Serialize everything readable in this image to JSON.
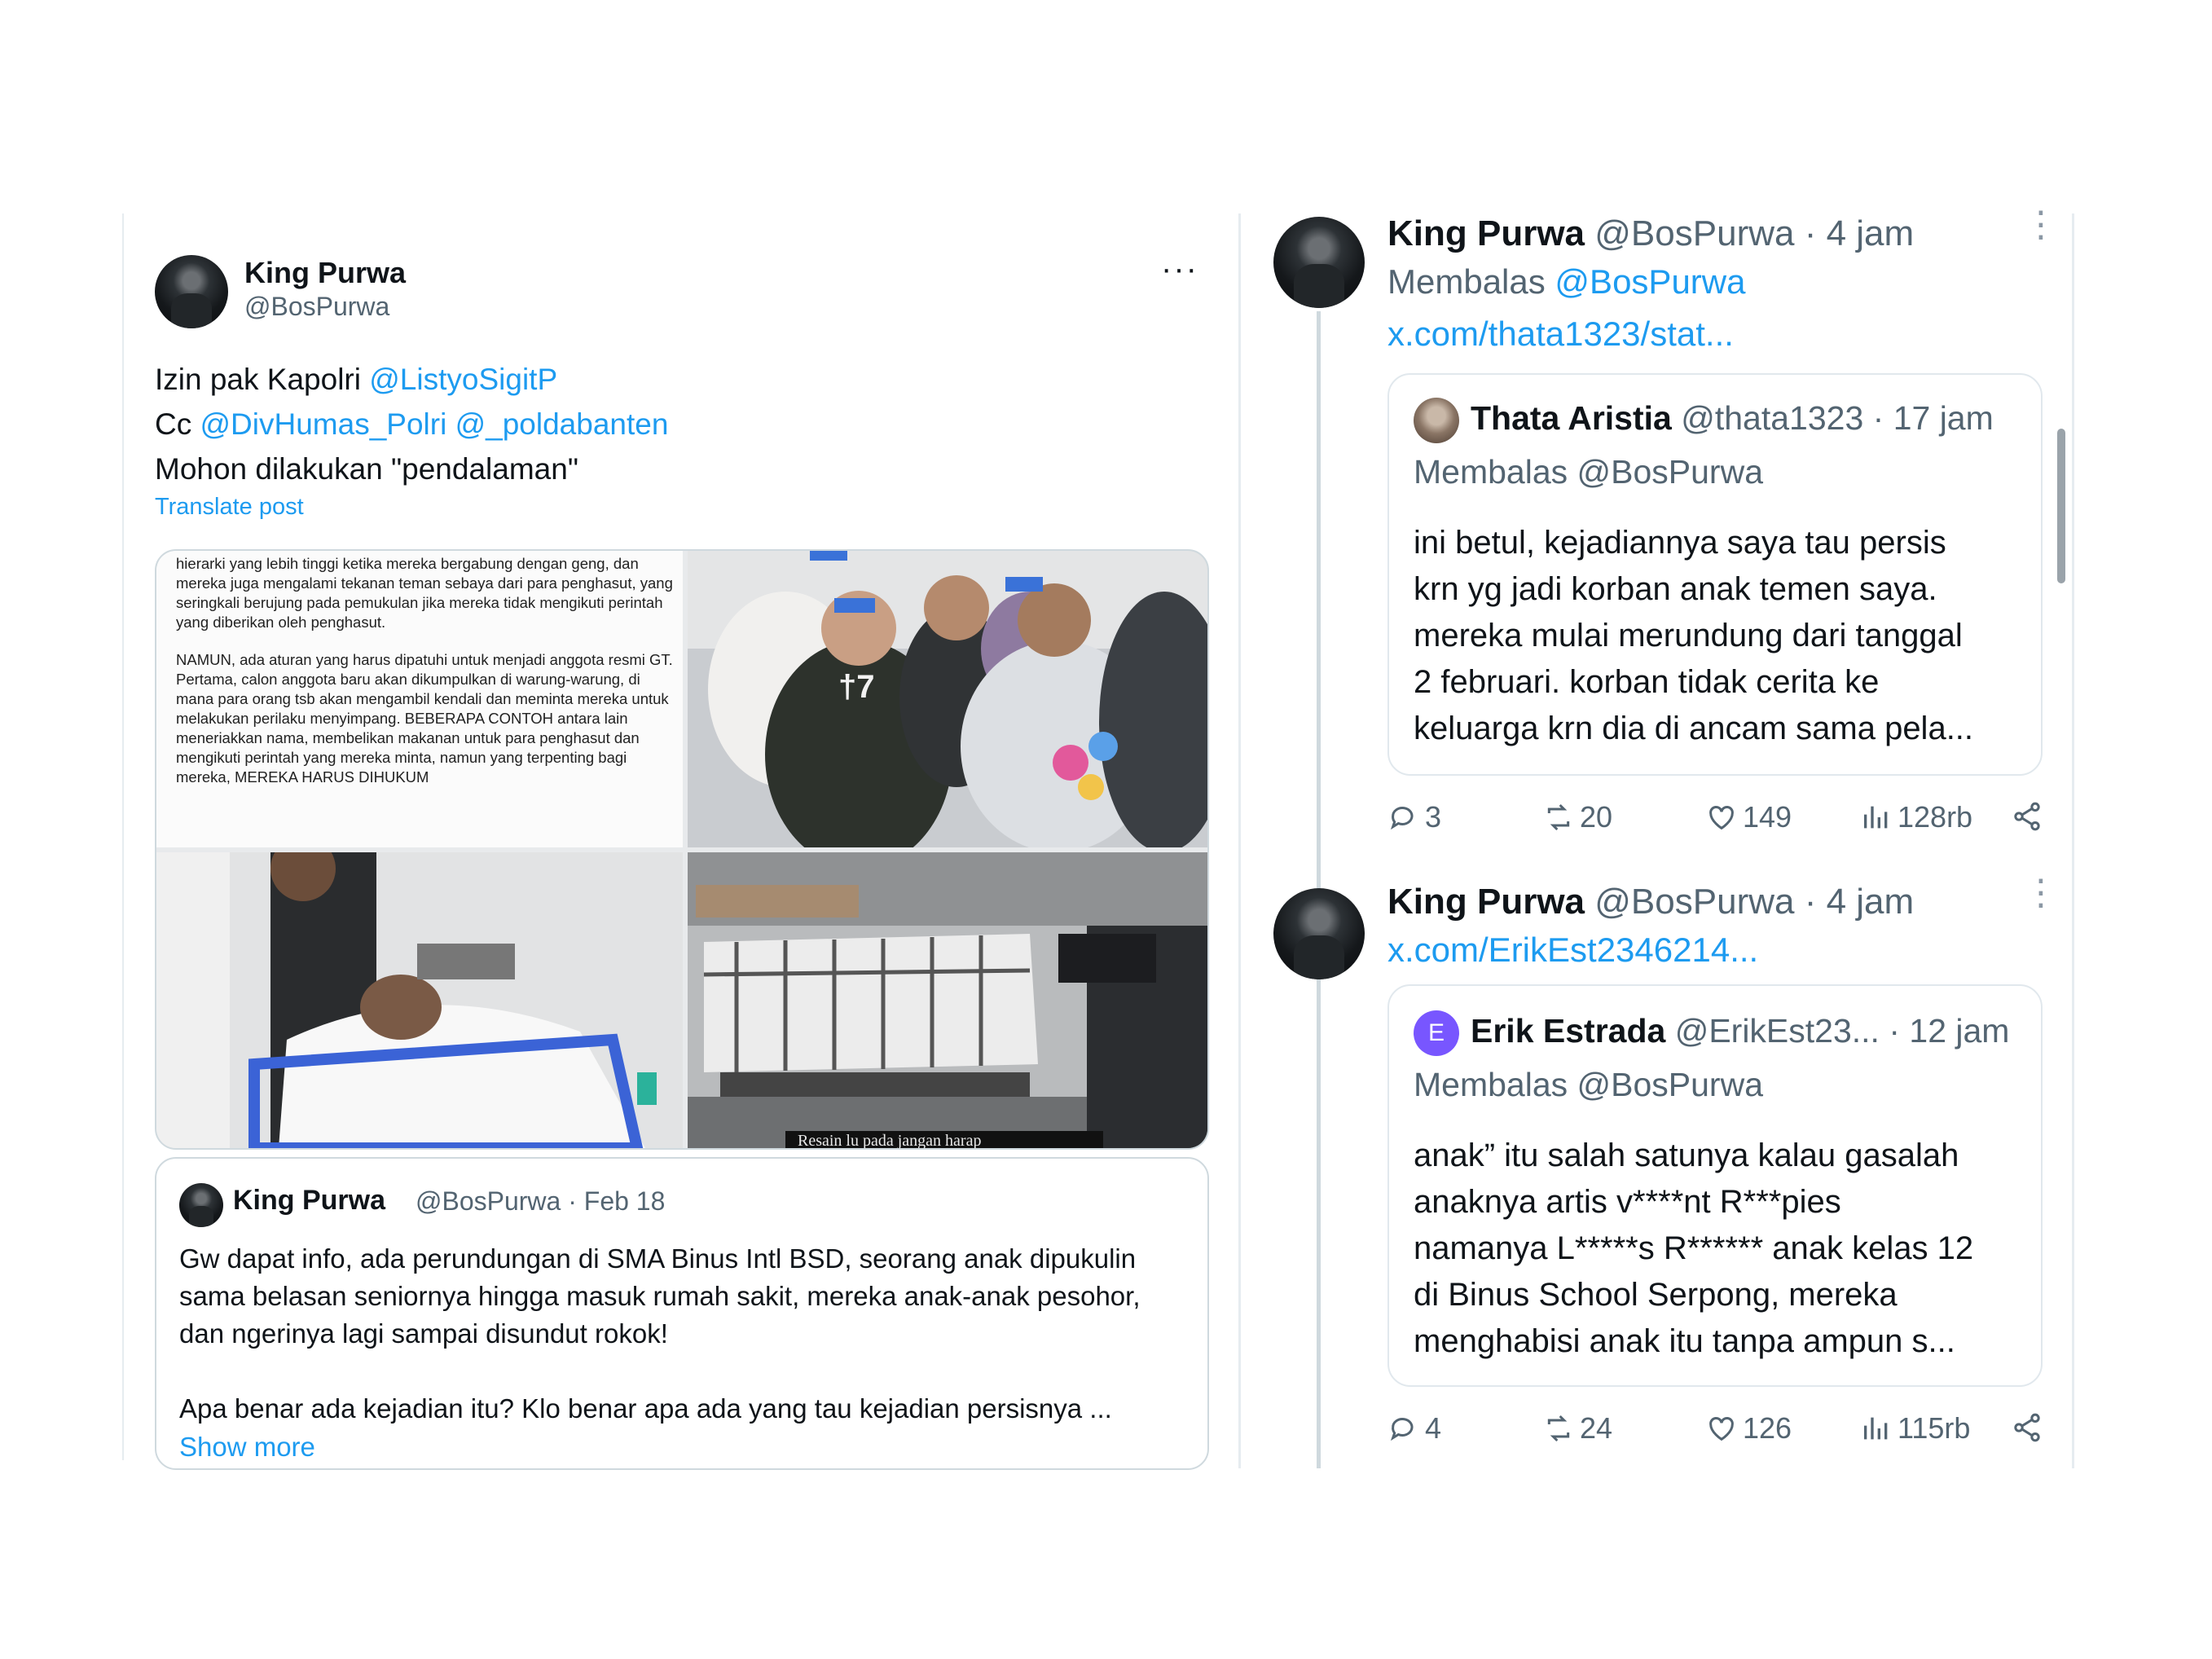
{
  "left_post": {
    "name": "King Purwa",
    "handle": "@BosPurwa",
    "more": "···",
    "lines": [
      {
        "prefix": "Izin pak Kapolri ",
        "mentions": "@ListyoSigitP"
      },
      {
        "prefix": "Cc ",
        "mentions": "@DivHumas_Polri @_poldabanten"
      },
      {
        "prefix": "Mohon dilakukan \"pendalaman\"",
        "mentions": ""
      }
    ],
    "translate": "Translate post",
    "media": {
      "doc_text": "hierarki yang lebih tinggi ketika mereka bergabung dengan geng, dan mereka juga mengalami tekanan teman sebaya dari para penghasut, yang seringkali berujung pada pemukulan jika mereka tidak mengikuti perintah yang diberikan oleh penghasut.",
      "doc_text2": "NAMUN, ada aturan yang harus dipatuhi untuk menjadi anggota resmi GT. Pertama, calon anggota baru akan dikumpulkan di warung-warung, di mana para orang tsb akan mengambil kendali dan meminta mereka untuk melakukan perilaku menyimpang. BEBERAPA CONTOH antara lain meneriakkan nama, membelikan makanan untuk para penghasut dan mengikuti perintah yang mereka minta, namun yang terpenting bagi mereka, MEREKA HARUS DIHUKUM",
      "subtitle": "Resain lu pada jangan harap"
    },
    "quote": {
      "name": "King Purwa",
      "handle": "@BosPurwa",
      "date": "Feb 18",
      "text1": "Gw dapat info, ada perundungan di SMA Binus Intl BSD, seorang anak dipukulin sama belasan seniornya hingga masuk rumah sakit, mereka anak-anak pesohor, dan ngerinya lagi sampai disundut rokok!",
      "text2": "Apa benar ada kejadian itu? Klo benar apa ada yang tau kejadian persisnya ...",
      "show_more": "Show more"
    }
  },
  "right_thread": {
    "reply1": {
      "name": "King Purwa",
      "handle": "@BosPurwa",
      "time": "4 jam",
      "replying_label": "Membalas",
      "replying_to": "@BosPurwa",
      "link": "x.com/thata1323/stat...",
      "quoted": {
        "avatar_letter": "",
        "name": "Thata Aristia",
        "handle": "@thata1323",
        "time": "17 jam",
        "replying": "Membalas @BosPurwa",
        "lines": [
          "ini betul, kejadiannya saya tau persis",
          "krn yg jadi korban anak temen saya.",
          "mereka mulai merundung dari tanggal",
          "2 februari. korban tidak cerita ke",
          "keluarga krn dia di ancam sama pela..."
        ]
      },
      "stats": {
        "replies": "3",
        "reposts": "20",
        "likes": "149",
        "views": "128rb"
      }
    },
    "reply2": {
      "name": "King Purwa",
      "handle": "@BosPurwa",
      "time": "4 jam",
      "link": "x.com/ErikEst2346214...",
      "quoted": {
        "avatar_letter": "E",
        "name": "Erik Estrada",
        "handle": "@ErikEst23...",
        "time": "12 jam",
        "replying": "Membalas @BosPurwa",
        "lines": [
          "anak” itu salah satunya kalau gasalah",
          "anaknya artis v****nt R***pies",
          "namanya L*****s R****** anak kelas 12",
          "di Binus School Serpong, mereka",
          "menghabisi anak itu tanpa ampun s..."
        ]
      },
      "stats": {
        "replies": "4",
        "reposts": "24",
        "likes": "126",
        "views": "115rb"
      }
    }
  },
  "colors": {
    "accent": "#1d9bf0",
    "muted": "#536471",
    "border": "#cfd9de"
  }
}
